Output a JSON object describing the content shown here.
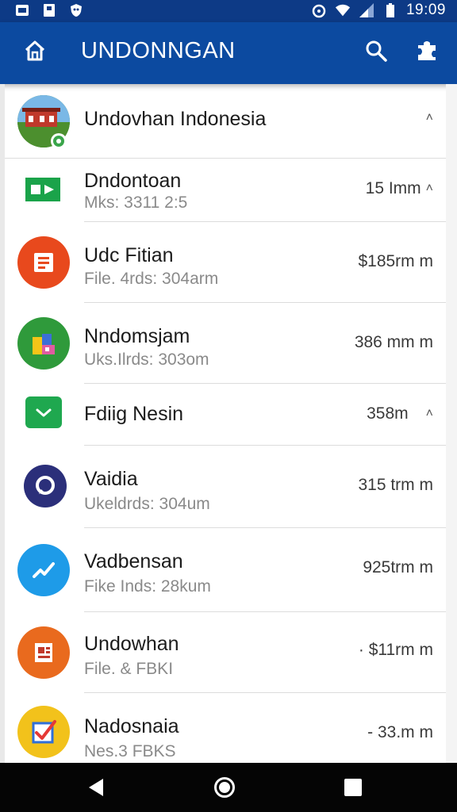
{
  "status_bar": {
    "time": "19:09",
    "icons": [
      "image-icon",
      "document-icon",
      "shield-icon",
      "alarm-icon",
      "wifi-icon",
      "signal-icon",
      "battery-icon"
    ]
  },
  "app_bar": {
    "title": "UNDONNGAN",
    "home_icon": "home-icon",
    "search_icon": "search-icon",
    "settings_icon": "puzzle-icon",
    "color": "#0c4aa0"
  },
  "list": {
    "header": {
      "title": "Undovhan  Indonesia",
      "chevron": "˄"
    },
    "items": [
      {
        "title": "Dndontoan",
        "subtitle": "Mks: 3311 2:5",
        "meta": "15 Imm",
        "chevron": "˄",
        "icon": "video-icon",
        "color": "#1aa34a"
      },
      {
        "title": "Udc Fitian",
        "subtitle": "File. 4rds: 304arm",
        "meta": "$185rm m",
        "chevron": "",
        "icon": "slides-icon",
        "color": "#e8491d"
      },
      {
        "title": "Nndomsjam",
        "subtitle": "Uks.Ilrds: 303om",
        "meta": "386 mm m",
        "chevron": "",
        "icon": "blocks-icon",
        "color": "#2f9a3b"
      },
      {
        "title": "Fdiig Nesin",
        "subtitle": "",
        "meta": "358m",
        "chevron": "˄",
        "icon": "chat-icon",
        "color": "#1fa84f"
      },
      {
        "title": "Vaidia",
        "subtitle": "Ukeldrds: 304um",
        "meta": "315 trm m",
        "chevron": "",
        "icon": "messenger-icon",
        "color": "#2b2f7a"
      },
      {
        "title": "Vadbensan",
        "subtitle": "Fike Inds: 28kum",
        "meta": "925trm m",
        "chevron": "",
        "icon": "messenger-bubble-icon",
        "color": "#1e9be8"
      },
      {
        "title": "Undowhan",
        "subtitle": "File. & FBKI",
        "meta": "· $11rm m",
        "chevron": "",
        "icon": "document-icon",
        "color": "#e96a1e"
      },
      {
        "title": "Nadosnaia",
        "subtitle": "Nes.3 FBKS",
        "meta": "- 33.m m",
        "chevron": "",
        "icon": "checkmark-icon",
        "color": "#f2c21b"
      }
    ]
  },
  "nav_bar": {
    "back_icon": "back-triangle-icon",
    "home_icon": "home-circle-icon",
    "recent_icon": "recent-square-icon"
  }
}
